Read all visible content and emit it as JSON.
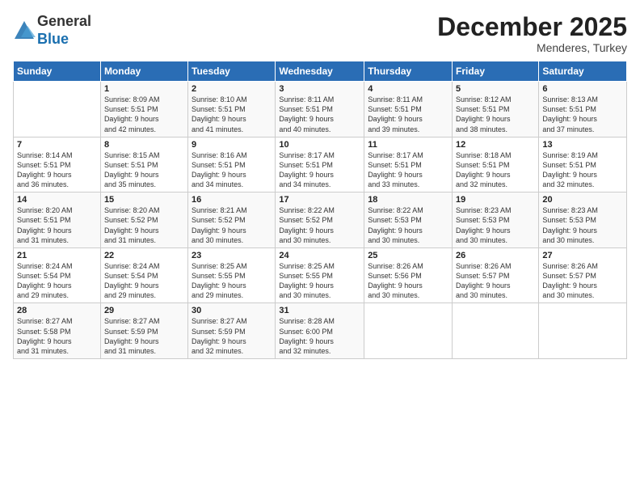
{
  "logo": {
    "general": "General",
    "blue": "Blue"
  },
  "header": {
    "month": "December 2025",
    "location": "Menderes, Turkey"
  },
  "weekdays": [
    "Sunday",
    "Monday",
    "Tuesday",
    "Wednesday",
    "Thursday",
    "Friday",
    "Saturday"
  ],
  "weeks": [
    [
      {
        "day": "",
        "info": ""
      },
      {
        "day": "1",
        "info": "Sunrise: 8:09 AM\nSunset: 5:51 PM\nDaylight: 9 hours\nand 42 minutes."
      },
      {
        "day": "2",
        "info": "Sunrise: 8:10 AM\nSunset: 5:51 PM\nDaylight: 9 hours\nand 41 minutes."
      },
      {
        "day": "3",
        "info": "Sunrise: 8:11 AM\nSunset: 5:51 PM\nDaylight: 9 hours\nand 40 minutes."
      },
      {
        "day": "4",
        "info": "Sunrise: 8:11 AM\nSunset: 5:51 PM\nDaylight: 9 hours\nand 39 minutes."
      },
      {
        "day": "5",
        "info": "Sunrise: 8:12 AM\nSunset: 5:51 PM\nDaylight: 9 hours\nand 38 minutes."
      },
      {
        "day": "6",
        "info": "Sunrise: 8:13 AM\nSunset: 5:51 PM\nDaylight: 9 hours\nand 37 minutes."
      }
    ],
    [
      {
        "day": "7",
        "info": "Sunrise: 8:14 AM\nSunset: 5:51 PM\nDaylight: 9 hours\nand 36 minutes."
      },
      {
        "day": "8",
        "info": "Sunrise: 8:15 AM\nSunset: 5:51 PM\nDaylight: 9 hours\nand 35 minutes."
      },
      {
        "day": "9",
        "info": "Sunrise: 8:16 AM\nSunset: 5:51 PM\nDaylight: 9 hours\nand 34 minutes."
      },
      {
        "day": "10",
        "info": "Sunrise: 8:17 AM\nSunset: 5:51 PM\nDaylight: 9 hours\nand 34 minutes."
      },
      {
        "day": "11",
        "info": "Sunrise: 8:17 AM\nSunset: 5:51 PM\nDaylight: 9 hours\nand 33 minutes."
      },
      {
        "day": "12",
        "info": "Sunrise: 8:18 AM\nSunset: 5:51 PM\nDaylight: 9 hours\nand 32 minutes."
      },
      {
        "day": "13",
        "info": "Sunrise: 8:19 AM\nSunset: 5:51 PM\nDaylight: 9 hours\nand 32 minutes."
      }
    ],
    [
      {
        "day": "14",
        "info": "Sunrise: 8:20 AM\nSunset: 5:51 PM\nDaylight: 9 hours\nand 31 minutes."
      },
      {
        "day": "15",
        "info": "Sunrise: 8:20 AM\nSunset: 5:52 PM\nDaylight: 9 hours\nand 31 minutes."
      },
      {
        "day": "16",
        "info": "Sunrise: 8:21 AM\nSunset: 5:52 PM\nDaylight: 9 hours\nand 30 minutes."
      },
      {
        "day": "17",
        "info": "Sunrise: 8:22 AM\nSunset: 5:52 PM\nDaylight: 9 hours\nand 30 minutes."
      },
      {
        "day": "18",
        "info": "Sunrise: 8:22 AM\nSunset: 5:53 PM\nDaylight: 9 hours\nand 30 minutes."
      },
      {
        "day": "19",
        "info": "Sunrise: 8:23 AM\nSunset: 5:53 PM\nDaylight: 9 hours\nand 30 minutes."
      },
      {
        "day": "20",
        "info": "Sunrise: 8:23 AM\nSunset: 5:53 PM\nDaylight: 9 hours\nand 30 minutes."
      }
    ],
    [
      {
        "day": "21",
        "info": "Sunrise: 8:24 AM\nSunset: 5:54 PM\nDaylight: 9 hours\nand 29 minutes."
      },
      {
        "day": "22",
        "info": "Sunrise: 8:24 AM\nSunset: 5:54 PM\nDaylight: 9 hours\nand 29 minutes."
      },
      {
        "day": "23",
        "info": "Sunrise: 8:25 AM\nSunset: 5:55 PM\nDaylight: 9 hours\nand 29 minutes."
      },
      {
        "day": "24",
        "info": "Sunrise: 8:25 AM\nSunset: 5:55 PM\nDaylight: 9 hours\nand 30 minutes."
      },
      {
        "day": "25",
        "info": "Sunrise: 8:26 AM\nSunset: 5:56 PM\nDaylight: 9 hours\nand 30 minutes."
      },
      {
        "day": "26",
        "info": "Sunrise: 8:26 AM\nSunset: 5:57 PM\nDaylight: 9 hours\nand 30 minutes."
      },
      {
        "day": "27",
        "info": "Sunrise: 8:26 AM\nSunset: 5:57 PM\nDaylight: 9 hours\nand 30 minutes."
      }
    ],
    [
      {
        "day": "28",
        "info": "Sunrise: 8:27 AM\nSunset: 5:58 PM\nDaylight: 9 hours\nand 31 minutes."
      },
      {
        "day": "29",
        "info": "Sunrise: 8:27 AM\nSunset: 5:59 PM\nDaylight: 9 hours\nand 31 minutes."
      },
      {
        "day": "30",
        "info": "Sunrise: 8:27 AM\nSunset: 5:59 PM\nDaylight: 9 hours\nand 32 minutes."
      },
      {
        "day": "31",
        "info": "Sunrise: 8:28 AM\nSunset: 6:00 PM\nDaylight: 9 hours\nand 32 minutes."
      },
      {
        "day": "",
        "info": ""
      },
      {
        "day": "",
        "info": ""
      },
      {
        "day": "",
        "info": ""
      }
    ]
  ]
}
